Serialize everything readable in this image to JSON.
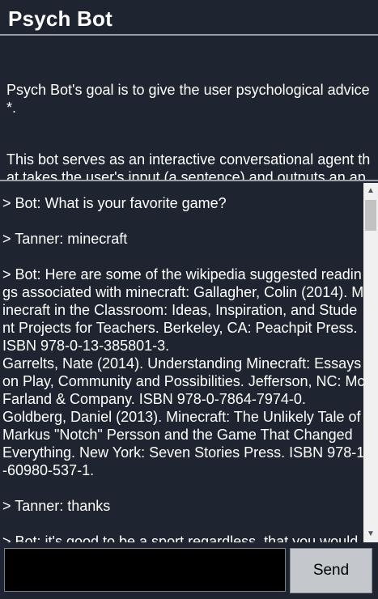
{
  "app": {
    "title": "Psych Bot"
  },
  "description": {
    "lines": [
      "Psych Bot's goal is to give the user psychological advice*.",
      "This bot serves as an interactive conversational agent that takes the user's input (a sentence) and outputs an appropriate response. As this assignment does not require Machine Learning implementation, the chatbot may provide a reply that may not relate to the user's prompt."
    ]
  },
  "chat": {
    "messages": [
      "> Bot: What is your favorite game?",
      "> Tanner: minecraft",
      "> Bot: Here are some of the wikipedia suggested readings associated with minecraft: Gallagher, Colin (2014). Minecraft in the Classroom: Ideas, Inspiration, and Student Projects for Teachers. Berkeley, CA: Peachpit Press. ISBN 978-0-13-385801-3.\nGarrelts, Nate (2014). Understanding Minecraft: Essays on Play, Community and Possibilities. Jefferson, NC: McFarland & Company. ISBN 978-0-7864-7974-0.\nGoldberg, Daniel (2013). Minecraft: The Unlikely Tale of Markus \"Notch\" Persson and the Game That Changed Everything. New York: Seven Stories Press. ISBN 978-1-60980-537-1.",
      "> Tanner: thanks",
      "> Bot: it's good to be a sport regardless, that you would"
    ]
  },
  "input": {
    "value": "",
    "placeholder": ""
  },
  "send_button": {
    "label": "Send"
  },
  "icons": {
    "scroll_up": "scroll-up-arrow-icon",
    "scroll_down": "scroll-down-arrow-icon"
  },
  "colors": {
    "background": "#1e2430",
    "text": "#ffffff",
    "button": "#c4c8cc"
  }
}
